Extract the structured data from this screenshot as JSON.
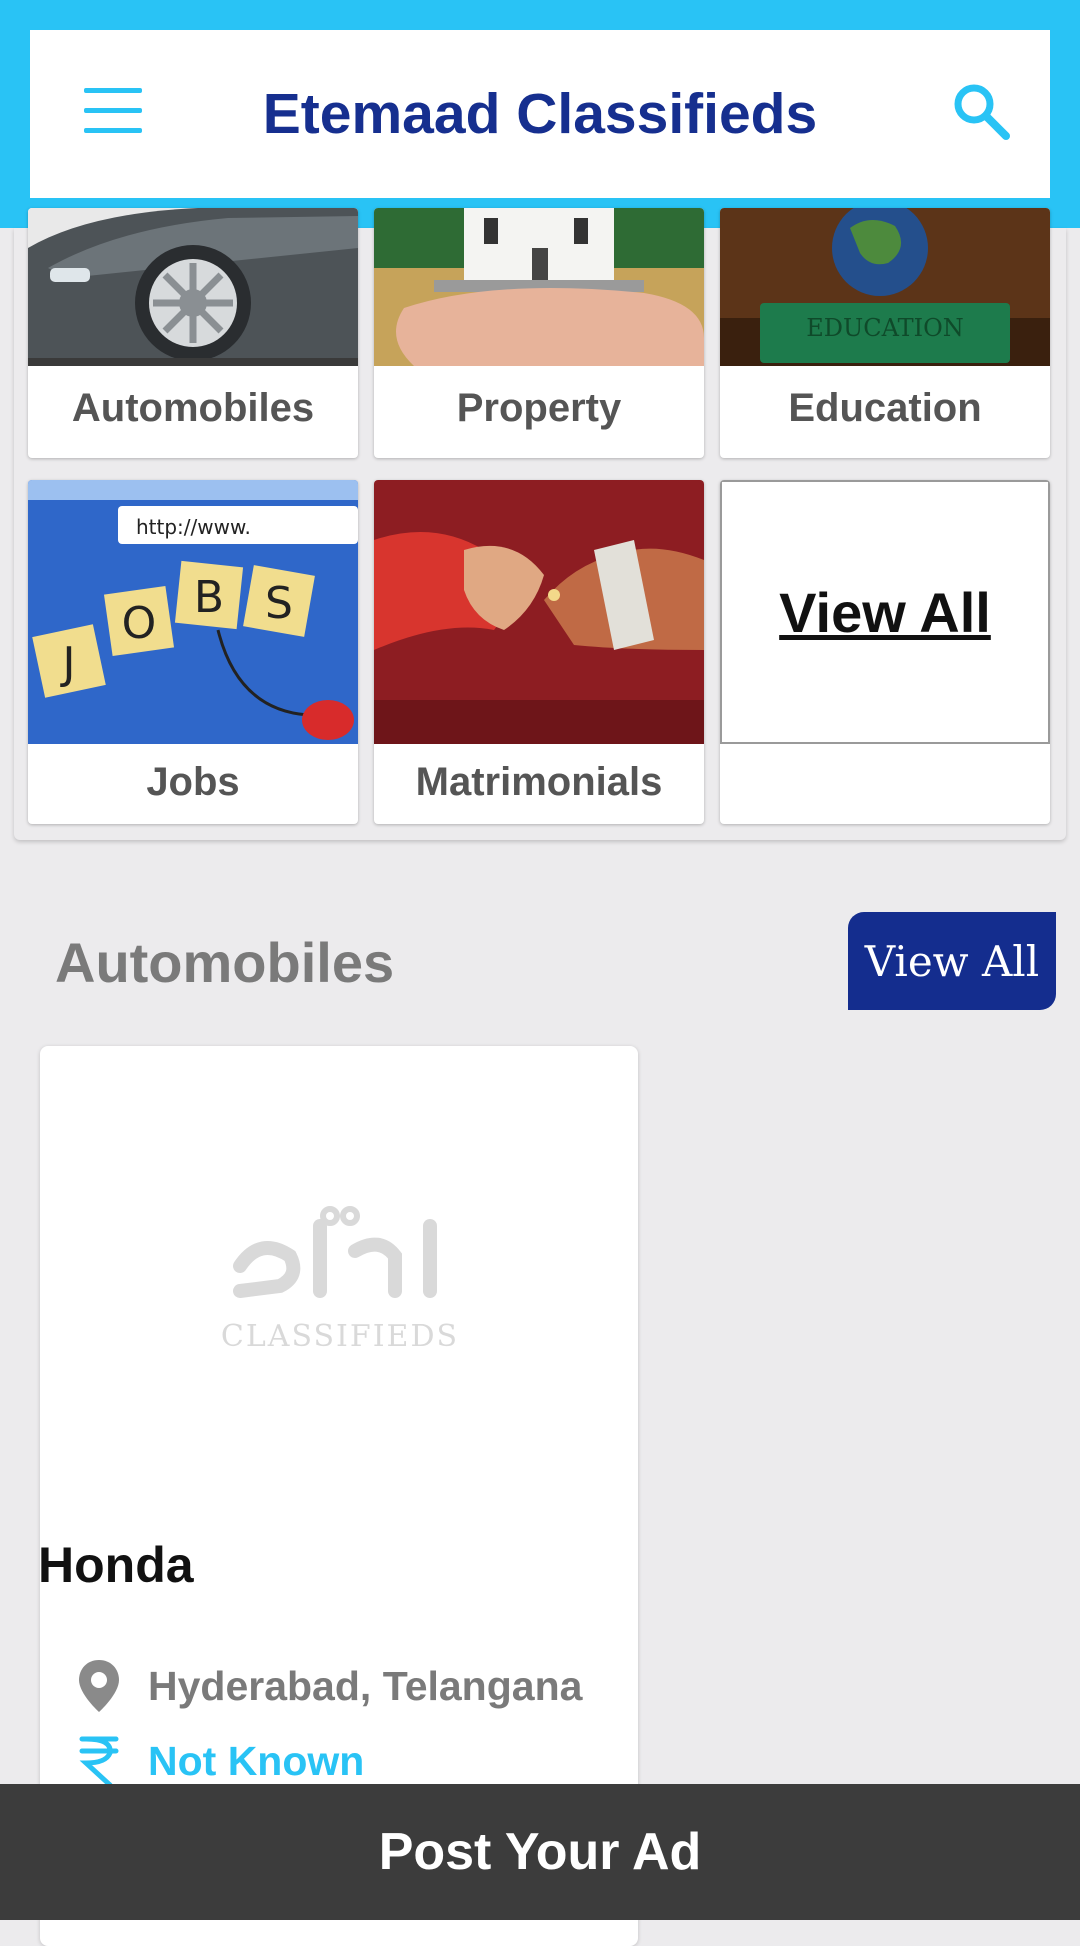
{
  "app": {
    "title": "Etemaad Classifieds"
  },
  "categories": [
    {
      "label": "Automobiles"
    },
    {
      "label": "Property"
    },
    {
      "label": "Education"
    },
    {
      "label": "Jobs"
    },
    {
      "label": "Matrimonials"
    },
    {
      "label": "View All"
    }
  ],
  "tile_image_text": {
    "education_book": "EDUCATION",
    "jobs_url": "http://www.",
    "jobs_letters": [
      "J",
      "O",
      "B",
      "S"
    ]
  },
  "section": {
    "title": "Automobiles",
    "view_all_label": "View All"
  },
  "listing": {
    "title": "Honda",
    "location": "Hyderabad, Telangana",
    "price": "Not Known",
    "logo_text": "CLASSIFIEDS"
  },
  "bottom": {
    "post_ad_label": "Post Your Ad"
  },
  "colors": {
    "accent": "#29c3f5",
    "brand_blue": "#142d8e",
    "bottom_bar": "#3c3c3c"
  }
}
